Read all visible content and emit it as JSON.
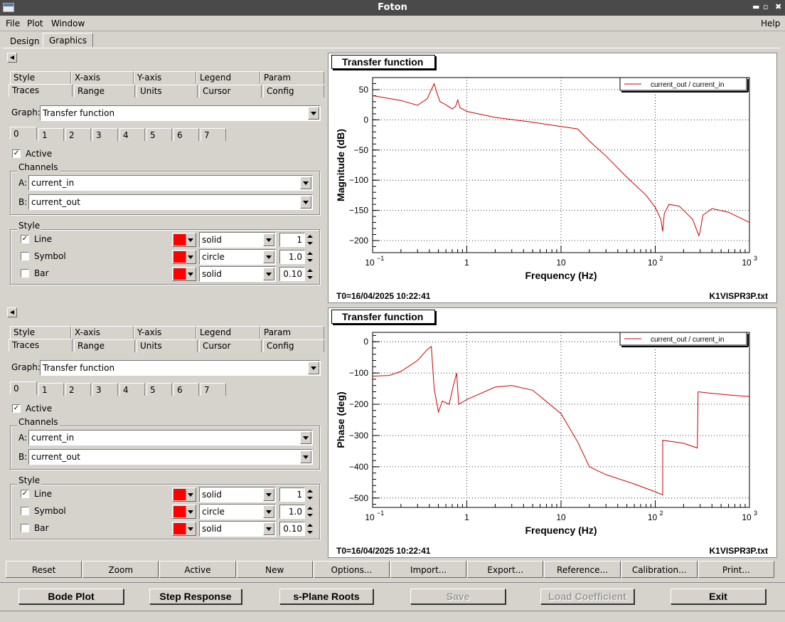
{
  "window": {
    "title": "Foton"
  },
  "menu": {
    "file": "File",
    "plot": "Plot",
    "window": "Window",
    "help": "Help"
  },
  "top_tabs": [
    "Design",
    "Graphics"
  ],
  "panel": {
    "tabs_row1": [
      "Style",
      "X-axis",
      "Y-axis",
      "Legend",
      "Param"
    ],
    "tabs_row2": [
      "Traces",
      "Range",
      "Units",
      "Cursor",
      "Config"
    ],
    "graph_label": "Graph:",
    "graph_value": "Transfer function",
    "trace_tabs": [
      "0",
      "1",
      "2",
      "3",
      "4",
      "5",
      "6",
      "7"
    ],
    "active_label": "Active",
    "channels_title": "Channels",
    "a_label": "A:",
    "a_value": "current_in",
    "b_label": "B:",
    "b_value": "current_out",
    "style_title": "Style",
    "line_label": "Line",
    "symbol_label": "Symbol",
    "bar_label": "Bar",
    "line_style": "solid",
    "symbol_style": "circle",
    "bar_style": "solid",
    "line_width": "1",
    "symbol_size": "1.0",
    "bar_width": "0.10",
    "trace_color": "#ff0000"
  },
  "plot1": {
    "title": "Transfer function",
    "legend": "current_out / current_in",
    "ylabel": "Magnitude (dB)",
    "xlabel": "Frequency (Hz)",
    "yticks": [
      "50",
      "0",
      "−50",
      "−100",
      "−150",
      "−200"
    ],
    "xticks": [
      "10",
      "1",
      "10",
      "10"
    ],
    "xtick_exp": [
      "−1",
      "",
      "",
      "2",
      "3"
    ],
    "t0": "T0=16/04/2025 10:22:41",
    "file": "K1VISPR3P.txt"
  },
  "plot2": {
    "title": "Transfer function",
    "legend": "current_out / current_in",
    "ylabel": "Phase (deg)",
    "xlabel": "Frequency (Hz)",
    "yticks": [
      "0",
      "−100",
      "−200",
      "−300",
      "−400",
      "−500"
    ],
    "t0": "T0=16/04/2025 10:22:41",
    "file": "K1VISPR3P.txt"
  },
  "toolbar": [
    "Reset",
    "Zoom",
    "Active",
    "New",
    "Options...",
    "Import...",
    "Export...",
    "Reference...",
    "Calibration...",
    "Print..."
  ],
  "bottom_buttons": {
    "bode": "Bode Plot",
    "step": "Step Response",
    "splane": "s-Plane Roots",
    "save": "Save",
    "load": "Load Coefficient",
    "exit": "Exit"
  },
  "chart_data": [
    {
      "type": "line",
      "title": "Transfer function",
      "xlabel": "Frequency (Hz)",
      "ylabel": "Magnitude (dB)",
      "xscale": "log",
      "xlim": [
        0.1,
        1000
      ],
      "ylim": [
        -220,
        70
      ],
      "grid": true,
      "legend_position": "top-right",
      "series": [
        {
          "name": "current_out / current_in",
          "color": "#cc0000",
          "x": [
            0.1,
            0.2,
            0.3,
            0.38,
            0.42,
            0.45,
            0.48,
            0.52,
            0.6,
            0.7,
            0.76,
            0.8,
            0.85,
            1,
            2,
            5,
            10,
            15,
            20,
            30,
            50,
            80,
            100,
            115,
            120,
            125,
            140,
            180,
            250,
            290,
            300,
            320,
            400,
            600,
            1000
          ],
          "y": [
            40,
            32,
            24,
            35,
            50,
            60,
            45,
            30,
            25,
            18,
            22,
            33,
            20,
            14,
            4,
            -4,
            -11,
            -15,
            -35,
            -60,
            -95,
            -125,
            -145,
            -165,
            -185,
            -155,
            -140,
            -143,
            -165,
            -192,
            -185,
            -158,
            -147,
            -153,
            -170
          ]
        }
      ]
    },
    {
      "type": "line",
      "title": "Transfer function",
      "xlabel": "Frequency (Hz)",
      "ylabel": "Phase (deg)",
      "xscale": "log",
      "xlim": [
        0.1,
        1000
      ],
      "ylim": [
        -530,
        30
      ],
      "grid": true,
      "legend_position": "top-right",
      "series": [
        {
          "name": "current_out / current_in",
          "color": "#cc0000",
          "x": [
            0.1,
            0.15,
            0.2,
            0.3,
            0.38,
            0.42,
            0.45,
            0.5,
            0.55,
            0.65,
            0.72,
            0.78,
            0.82,
            1,
            2,
            3,
            5,
            10,
            15,
            20,
            30,
            60,
            100,
            120,
            120.1,
            200,
            280,
            285,
            400,
            700,
            1000
          ],
          "y": [
            -110,
            -108,
            -95,
            -60,
            -25,
            -15,
            -150,
            -225,
            -190,
            -200,
            -140,
            -100,
            -200,
            -185,
            -145,
            -140,
            -155,
            -230,
            -320,
            -400,
            -425,
            -455,
            -480,
            -490,
            -315,
            -325,
            -340,
            -160,
            -165,
            -172,
            -175
          ]
        }
      ]
    }
  ]
}
